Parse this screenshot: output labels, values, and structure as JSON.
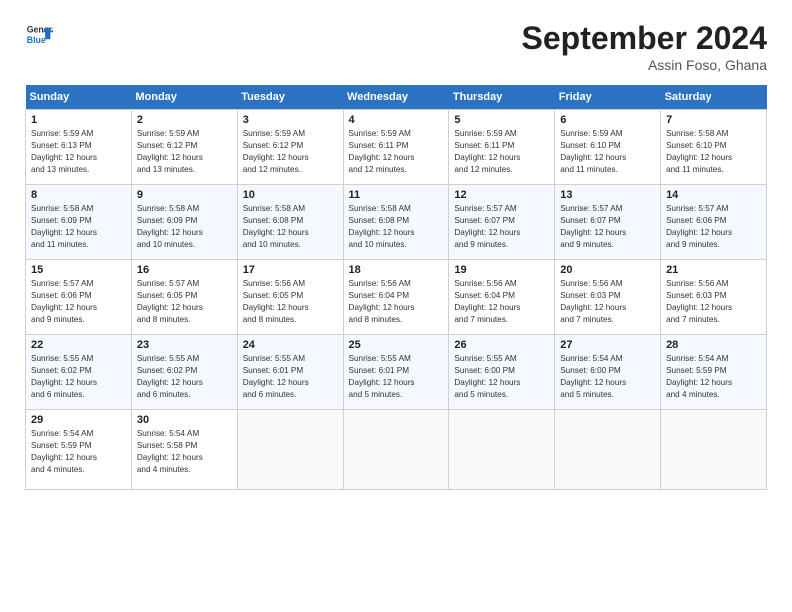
{
  "header": {
    "logo_line1": "General",
    "logo_line2": "Blue",
    "month": "September 2024",
    "location": "Assin Foso, Ghana"
  },
  "weekdays": [
    "Sunday",
    "Monday",
    "Tuesday",
    "Wednesday",
    "Thursday",
    "Friday",
    "Saturday"
  ],
  "weeks": [
    [
      {
        "day": "1",
        "info": "Sunrise: 5:59 AM\nSunset: 6:13 PM\nDaylight: 12 hours\nand 13 minutes."
      },
      {
        "day": "2",
        "info": "Sunrise: 5:59 AM\nSunset: 6:12 PM\nDaylight: 12 hours\nand 13 minutes."
      },
      {
        "day": "3",
        "info": "Sunrise: 5:59 AM\nSunset: 6:12 PM\nDaylight: 12 hours\nand 12 minutes."
      },
      {
        "day": "4",
        "info": "Sunrise: 5:59 AM\nSunset: 6:11 PM\nDaylight: 12 hours\nand 12 minutes."
      },
      {
        "day": "5",
        "info": "Sunrise: 5:59 AM\nSunset: 6:11 PM\nDaylight: 12 hours\nand 12 minutes."
      },
      {
        "day": "6",
        "info": "Sunrise: 5:59 AM\nSunset: 6:10 PM\nDaylight: 12 hours\nand 11 minutes."
      },
      {
        "day": "7",
        "info": "Sunrise: 5:58 AM\nSunset: 6:10 PM\nDaylight: 12 hours\nand 11 minutes."
      }
    ],
    [
      {
        "day": "8",
        "info": "Sunrise: 5:58 AM\nSunset: 6:09 PM\nDaylight: 12 hours\nand 11 minutes."
      },
      {
        "day": "9",
        "info": "Sunrise: 5:58 AM\nSunset: 6:09 PM\nDaylight: 12 hours\nand 10 minutes."
      },
      {
        "day": "10",
        "info": "Sunrise: 5:58 AM\nSunset: 6:08 PM\nDaylight: 12 hours\nand 10 minutes."
      },
      {
        "day": "11",
        "info": "Sunrise: 5:58 AM\nSunset: 6:08 PM\nDaylight: 12 hours\nand 10 minutes."
      },
      {
        "day": "12",
        "info": "Sunrise: 5:57 AM\nSunset: 6:07 PM\nDaylight: 12 hours\nand 9 minutes."
      },
      {
        "day": "13",
        "info": "Sunrise: 5:57 AM\nSunset: 6:07 PM\nDaylight: 12 hours\nand 9 minutes."
      },
      {
        "day": "14",
        "info": "Sunrise: 5:57 AM\nSunset: 6:06 PM\nDaylight: 12 hours\nand 9 minutes."
      }
    ],
    [
      {
        "day": "15",
        "info": "Sunrise: 5:57 AM\nSunset: 6:06 PM\nDaylight: 12 hours\nand 9 minutes."
      },
      {
        "day": "16",
        "info": "Sunrise: 5:57 AM\nSunset: 6:05 PM\nDaylight: 12 hours\nand 8 minutes."
      },
      {
        "day": "17",
        "info": "Sunrise: 5:56 AM\nSunset: 6:05 PM\nDaylight: 12 hours\nand 8 minutes."
      },
      {
        "day": "18",
        "info": "Sunrise: 5:56 AM\nSunset: 6:04 PM\nDaylight: 12 hours\nand 8 minutes."
      },
      {
        "day": "19",
        "info": "Sunrise: 5:56 AM\nSunset: 6:04 PM\nDaylight: 12 hours\nand 7 minutes."
      },
      {
        "day": "20",
        "info": "Sunrise: 5:56 AM\nSunset: 6:03 PM\nDaylight: 12 hours\nand 7 minutes."
      },
      {
        "day": "21",
        "info": "Sunrise: 5:56 AM\nSunset: 6:03 PM\nDaylight: 12 hours\nand 7 minutes."
      }
    ],
    [
      {
        "day": "22",
        "info": "Sunrise: 5:55 AM\nSunset: 6:02 PM\nDaylight: 12 hours\nand 6 minutes."
      },
      {
        "day": "23",
        "info": "Sunrise: 5:55 AM\nSunset: 6:02 PM\nDaylight: 12 hours\nand 6 minutes."
      },
      {
        "day": "24",
        "info": "Sunrise: 5:55 AM\nSunset: 6:01 PM\nDaylight: 12 hours\nand 6 minutes."
      },
      {
        "day": "25",
        "info": "Sunrise: 5:55 AM\nSunset: 6:01 PM\nDaylight: 12 hours\nand 5 minutes."
      },
      {
        "day": "26",
        "info": "Sunrise: 5:55 AM\nSunset: 6:00 PM\nDaylight: 12 hours\nand 5 minutes."
      },
      {
        "day": "27",
        "info": "Sunrise: 5:54 AM\nSunset: 6:00 PM\nDaylight: 12 hours\nand 5 minutes."
      },
      {
        "day": "28",
        "info": "Sunrise: 5:54 AM\nSunset: 5:59 PM\nDaylight: 12 hours\nand 4 minutes."
      }
    ],
    [
      {
        "day": "29",
        "info": "Sunrise: 5:54 AM\nSunset: 5:59 PM\nDaylight: 12 hours\nand 4 minutes."
      },
      {
        "day": "30",
        "info": "Sunrise: 5:54 AM\nSunset: 5:58 PM\nDaylight: 12 hours\nand 4 minutes."
      },
      {
        "day": "",
        "info": ""
      },
      {
        "day": "",
        "info": ""
      },
      {
        "day": "",
        "info": ""
      },
      {
        "day": "",
        "info": ""
      },
      {
        "day": "",
        "info": ""
      }
    ]
  ]
}
